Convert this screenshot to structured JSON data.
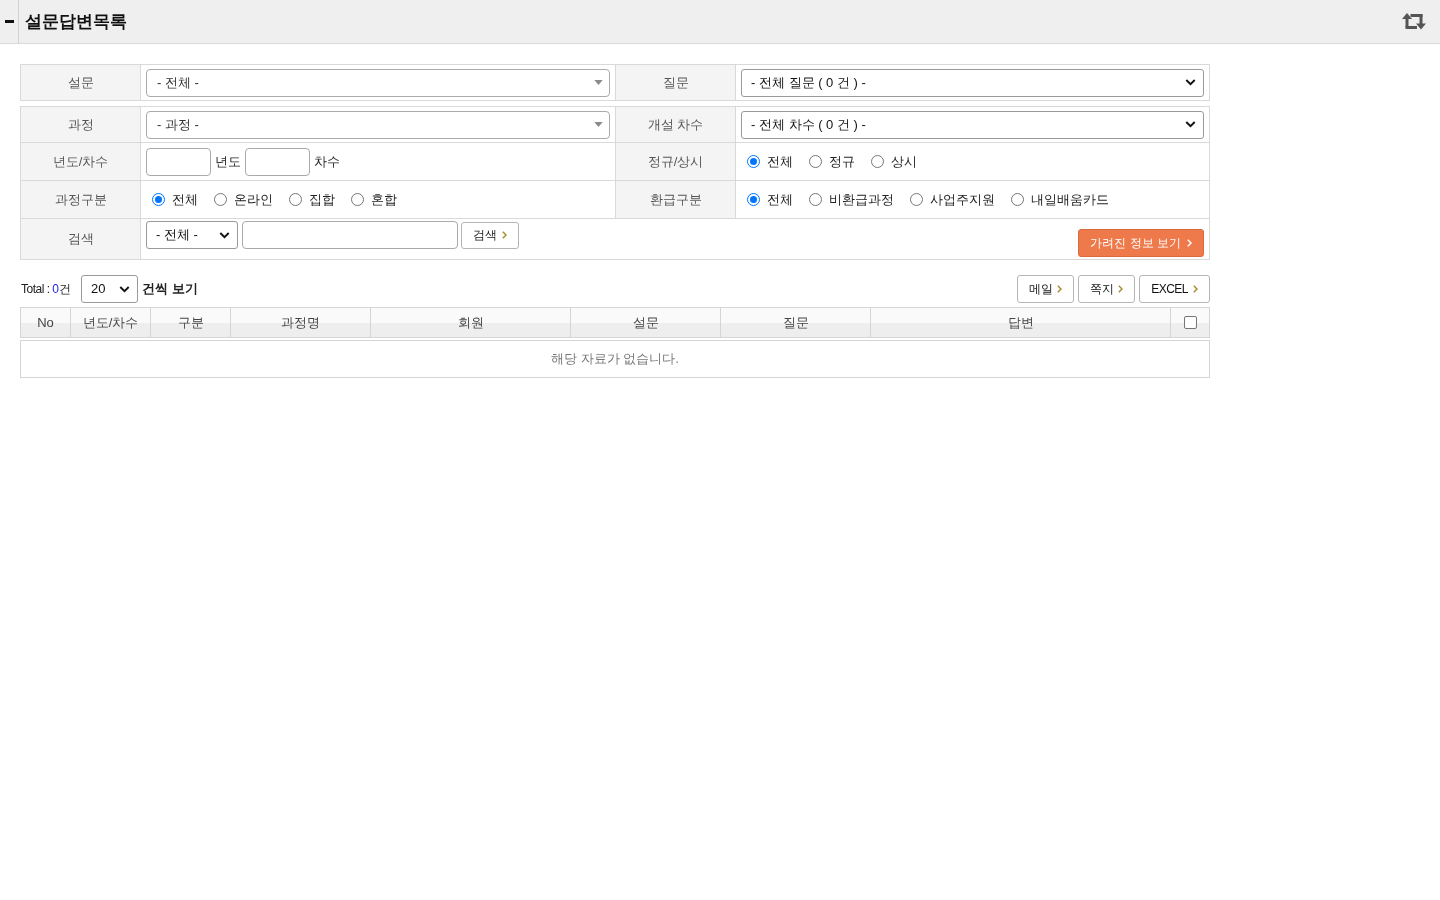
{
  "header": {
    "title": "설문답변목록"
  },
  "filters": {
    "survey": {
      "label": "설문",
      "value": "- 전체 -"
    },
    "question": {
      "label": "질문",
      "value": "- 전체 질문 ( 0 건 ) -"
    },
    "course": {
      "label": "과정",
      "value": "- 과정 -"
    },
    "session": {
      "label": "개설 차수",
      "value": "- 전체 차수 ( 0 건 ) -"
    },
    "year_session": {
      "label": "년도/차수",
      "year_unit": "년도",
      "session_unit": "차수"
    },
    "regular_type": {
      "label": "정규/상시",
      "options": [
        {
          "label": "전체",
          "selected": true
        },
        {
          "label": "정규",
          "selected": false
        },
        {
          "label": "상시",
          "selected": false
        }
      ]
    },
    "course_type": {
      "label": "과정구분",
      "options": [
        {
          "label": "전체",
          "selected": true
        },
        {
          "label": "온라인",
          "selected": false
        },
        {
          "label": "집합",
          "selected": false
        },
        {
          "label": "혼합",
          "selected": false
        }
      ]
    },
    "refund_type": {
      "label": "환급구분",
      "options": [
        {
          "label": "전체",
          "selected": true
        },
        {
          "label": "비환급과정",
          "selected": false
        },
        {
          "label": "사업주지원",
          "selected": false
        },
        {
          "label": "내일배움카드",
          "selected": false
        }
      ]
    },
    "search": {
      "label": "검색",
      "scope": "- 전체 -",
      "button": "검색"
    },
    "hidden_info_button": "가려진 정보 보기"
  },
  "list": {
    "total_label": "Total :",
    "total_count": "0",
    "total_unit": "건",
    "page_size": "20",
    "page_size_suffix": "건씩 보기",
    "actions": [
      "메일",
      "쪽지",
      "EXCEL"
    ],
    "columns": [
      "No",
      "년도/차수",
      "구분",
      "과정명",
      "회원",
      "설문",
      "질문",
      "답변"
    ],
    "select_all": {
      "checked": false
    },
    "empty_message": "해당 자료가 없습니다."
  }
}
